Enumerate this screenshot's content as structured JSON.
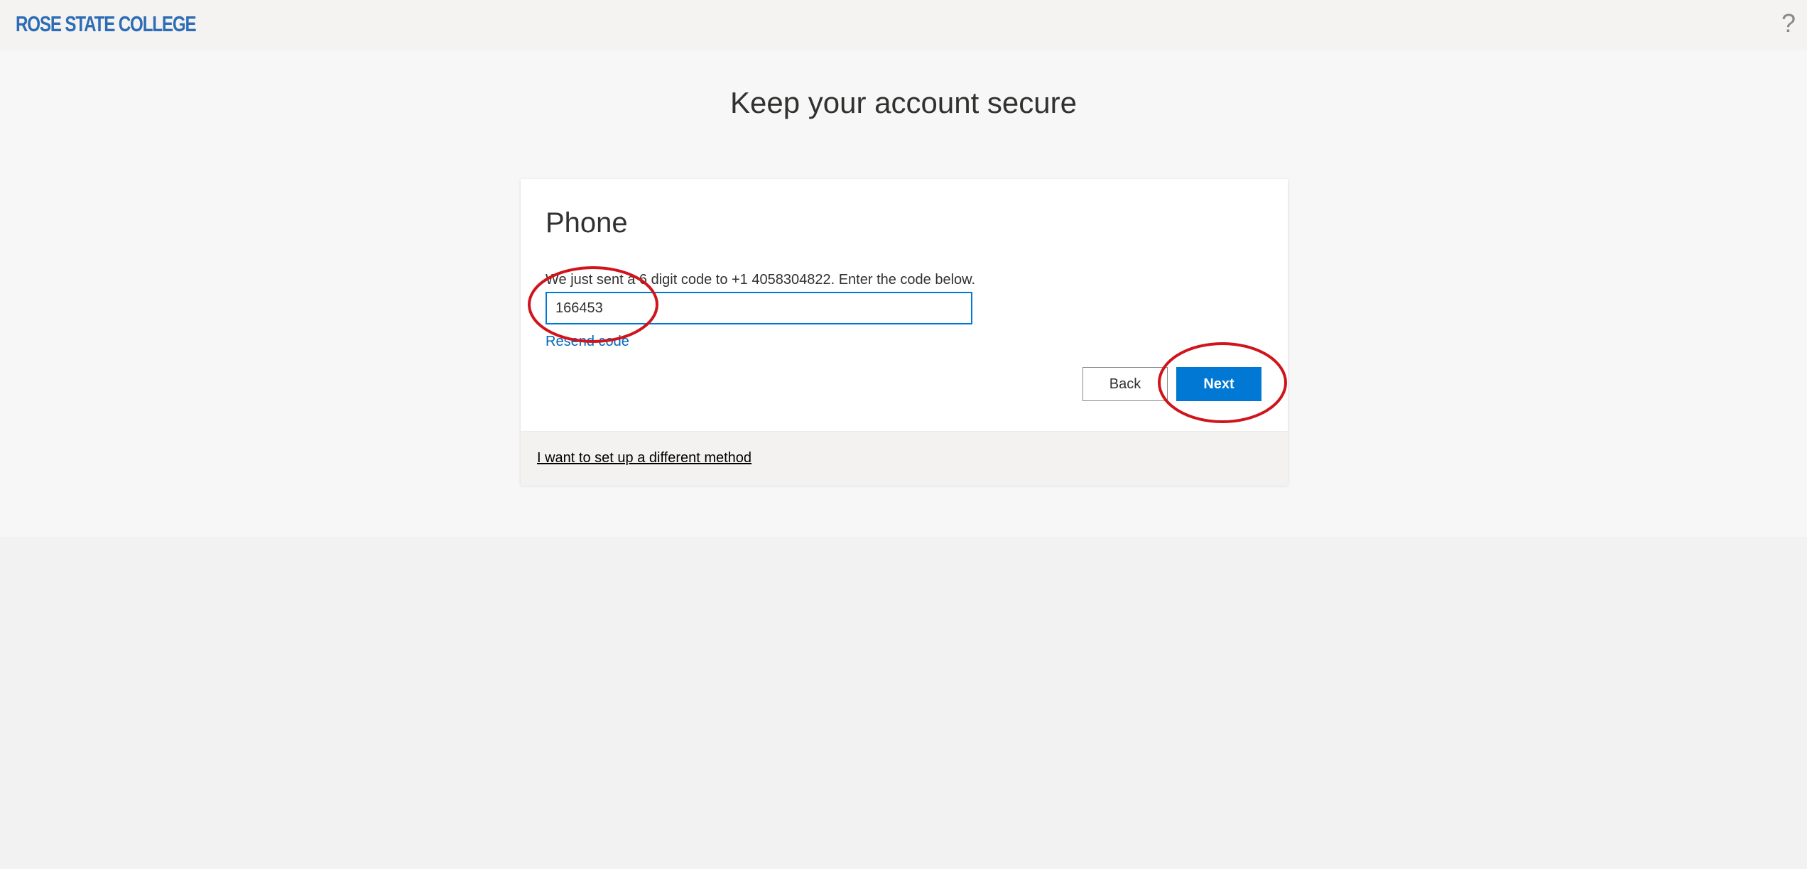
{
  "header": {
    "logo_text": "ROSE STATE COLLEGE",
    "help_label": "?"
  },
  "main": {
    "title": "Keep your account secure"
  },
  "card": {
    "title": "Phone",
    "instruction": "We just sent a 6 digit code to +1 4058304822. Enter the code below.",
    "code_value": "166453",
    "resend_label": "Resend code",
    "back_label": "Back",
    "next_label": "Next",
    "alt_method_label": "I want to set up a different method"
  },
  "colors": {
    "brand_logo": "#2d6db5",
    "accent": "#0078d4",
    "link": "#0067b8",
    "annotation_circle": "#d0141c"
  },
  "icons": {
    "help": "question-mark-icon"
  }
}
